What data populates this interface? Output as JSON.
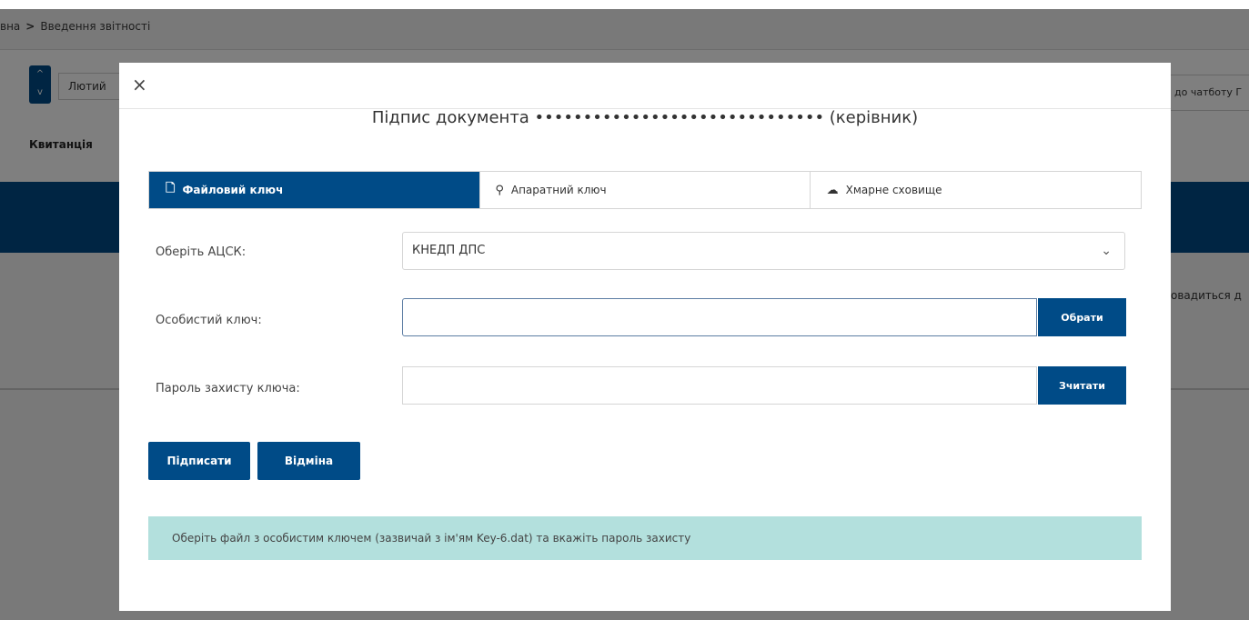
{
  "background": {
    "breadcrumb": {
      "parent": "вна",
      "separator": ">",
      "current": "Введення звітності"
    },
    "month": {
      "stepper_up": "^",
      "stepper_down": "v",
      "value": "Лютий"
    },
    "right_button": "до чатботу Г",
    "receipt_label": "Квитанція",
    "row_text": "овадиться д"
  },
  "modal": {
    "close_icon": "×",
    "title": "Підпис документа  •••••••••••••••••••••••••••••• (керівник)",
    "tabs": [
      {
        "icon": "file-icon",
        "glyph": "🗋",
        "label": "Файловий ключ",
        "active": true
      },
      {
        "icon": "search-key-icon",
        "glyph": "⚲",
        "label": "Апаратний ключ",
        "active": false
      },
      {
        "icon": "cloud-icon",
        "glyph": "☁",
        "label": "Хмарне сховище",
        "active": false
      }
    ],
    "acsk": {
      "label": "Оберіть АЦСК:",
      "value": "КНЕДП ДПС",
      "chevron": "⌄"
    },
    "private_key": {
      "label": "Особистий ключ:",
      "value": "",
      "button": "Обрати"
    },
    "password": {
      "label": "Пароль захисту ключа:",
      "value": "",
      "button": "Зчитати"
    },
    "sign_button": "Підписати",
    "cancel_button": "Відміна",
    "info": "Оберіть файл з особистим ключем (зазвичай з ім'ям Key-6.dat) та вкажіть пароль захисту"
  },
  "colors": {
    "primary": "#004b87",
    "info_bg": "#b3e0dd",
    "overlay": "rgba(0,0,0,0.5)"
  }
}
